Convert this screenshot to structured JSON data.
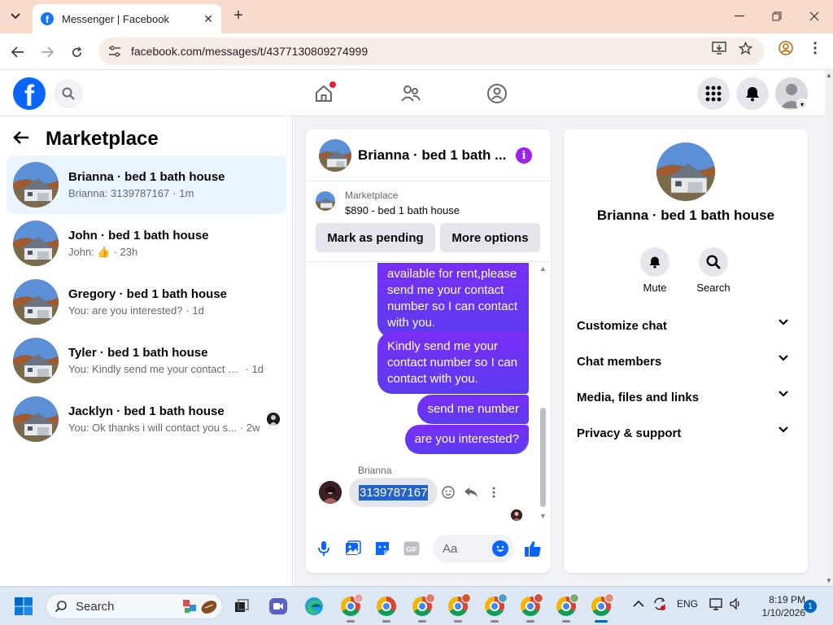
{
  "browser": {
    "tab_title": "Messenger | Facebook",
    "url": "facebook.com/messages/t/4377130809274999"
  },
  "left_panel": {
    "title": "Marketplace",
    "conversations": [
      {
        "name": "Brianna · bed 1 bath house",
        "message": "Brianna: 3139787167",
        "time": " · 1m",
        "active": true
      },
      {
        "name": "John · bed 1 bath house",
        "message": "John: 👍",
        "time": " · 23h",
        "active": false
      },
      {
        "name": "Gregory · bed 1 bath house",
        "message": "You: are you interested?",
        "time": " · 1d",
        "active": false
      },
      {
        "name": "Tyler · bed 1 bath house",
        "message": "You: Kindly send me your contact nu...",
        "time": " · 1d",
        "active": false
      },
      {
        "name": "Jacklyn · bed 1 bath house",
        "message": "You: Ok thanks i will contact you s...",
        "time": " · 2w",
        "active": false
      }
    ]
  },
  "chat": {
    "title": "Brianna · bed 1 bath ...",
    "listing_label": "Marketplace",
    "listing_price": "$890 - bed 1 bath house",
    "mark_pending": "Mark as pending",
    "more_options": "More options",
    "sent_messages": [
      "available for rent,please send me your contact number so I can contact with you.",
      "Kindly send me your contact number so I can contact with you.",
      "send me number",
      "are you interested?"
    ],
    "sender_name": "Brianna",
    "received_message": "3139787167",
    "composer_placeholder": "Aa"
  },
  "right_panel": {
    "name": "Brianna · bed 1 bath house",
    "mute_label": "Mute",
    "search_label": "Search",
    "sections": [
      "Customize chat",
      "Chat members",
      "Media, files and links",
      "Privacy & support"
    ]
  },
  "taskbar": {
    "search_placeholder": "Search",
    "language": "ENG",
    "time": "8:19 PM",
    "date": "1/10/2026",
    "notification_count": "1"
  },
  "colors": {
    "facebook_blue": "#0866ff",
    "bubble_purple": "#6a33f2",
    "selection_blue": "#2563c8",
    "active_row": "#ebf5ff"
  }
}
